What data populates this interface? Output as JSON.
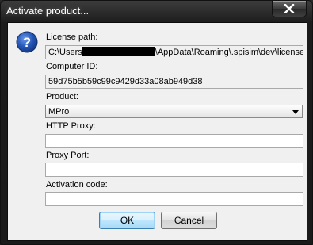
{
  "window": {
    "title": "Activate product..."
  },
  "icons": {
    "close": "close-icon",
    "info": "question-icon"
  },
  "license_path": {
    "label": "License path:",
    "value_prefix": "C:\\Users",
    "value_suffix": "\\AppData\\Roaming\\.spisim\\dev\\licenses"
  },
  "computer_id": {
    "label": "Computer ID:",
    "value": "59d75b5b59c99c9429d33a08ab949d38"
  },
  "product": {
    "label": "Product:",
    "value": "MPro"
  },
  "http_proxy": {
    "label": "HTTP Proxy:",
    "value": ""
  },
  "proxy_port": {
    "label": "Proxy Port:",
    "value": ""
  },
  "activation_code": {
    "label": "Activation code:",
    "value": ""
  },
  "buttons": {
    "ok": "OK",
    "cancel": "Cancel"
  },
  "colors": {
    "title_bar": "#1c1c1c",
    "client_bg": "#f0f0f0",
    "icon_blue": "#1f4fa8",
    "default_button_border": "#3c7fb1"
  }
}
